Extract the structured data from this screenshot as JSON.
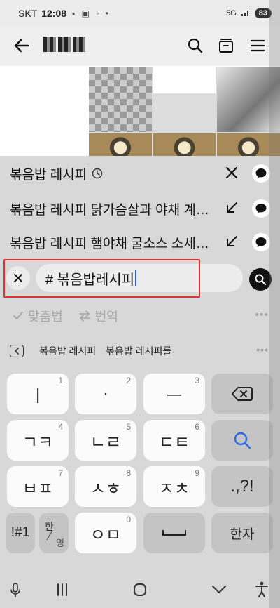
{
  "status": {
    "carrier": "SKT",
    "time": "12:08",
    "battery": "83",
    "network": "5G"
  },
  "suggestions": [
    {
      "text": "볶음밥 레시피",
      "icon": "clock-icon",
      "action": "delete"
    },
    {
      "text": "볶음밥 레시피 닭가슴살과 야채 계…",
      "icon": "",
      "action": "fill-arrow"
    },
    {
      "text": "볶음밥 레시피 햄야채 굴소스 소세…",
      "icon": "",
      "action": "fill-arrow"
    }
  ],
  "search": {
    "query": "# 볶음밥레시피"
  },
  "toolbar": {
    "spell_label": "맞춤법",
    "translate_label": "번역"
  },
  "predictions": [
    "볶음밥 레시피",
    "볶음밥 레시피를"
  ],
  "keyboard": {
    "rows": [
      [
        {
          "label": "ㅣ",
          "sub": "1"
        },
        {
          "label": "·",
          "sub": "2"
        },
        {
          "label": "ㅡ",
          "sub": "3"
        },
        {
          "label": "backspace",
          "sub": ""
        }
      ],
      [
        {
          "label": "ㄱㅋ",
          "sub": "4"
        },
        {
          "label": "ㄴㄹ",
          "sub": "5"
        },
        {
          "label": "ㄷㅌ",
          "sub": "6"
        },
        {
          "label": "search",
          "sub": ""
        }
      ],
      [
        {
          "label": "ㅂㅍ",
          "sub": "7"
        },
        {
          "label": "ㅅㅎ",
          "sub": "8"
        },
        {
          "label": "ㅈㅊ",
          "sub": "9"
        },
        {
          "label": ".,?!",
          "sub": ""
        }
      ],
      [
        {
          "label": "!#1",
          "sub": ""
        },
        {
          "label": "한/영",
          "sub": ""
        },
        {
          "label": "ㅇㅁ",
          "sub": "0"
        },
        {
          "label": "space",
          "sub": ""
        },
        {
          "label": "한자",
          "sub": ""
        }
      ]
    ],
    "sym_label": "!#1",
    "lang_top": "한",
    "lang_bottom": "영",
    "hanja_label": "한자",
    "punct_label": ".,?!",
    "accent_color": "#2d6be0"
  },
  "colors": {
    "highlight_outline": "#e0312f",
    "dim_overlay": "#d8d8d8"
  }
}
